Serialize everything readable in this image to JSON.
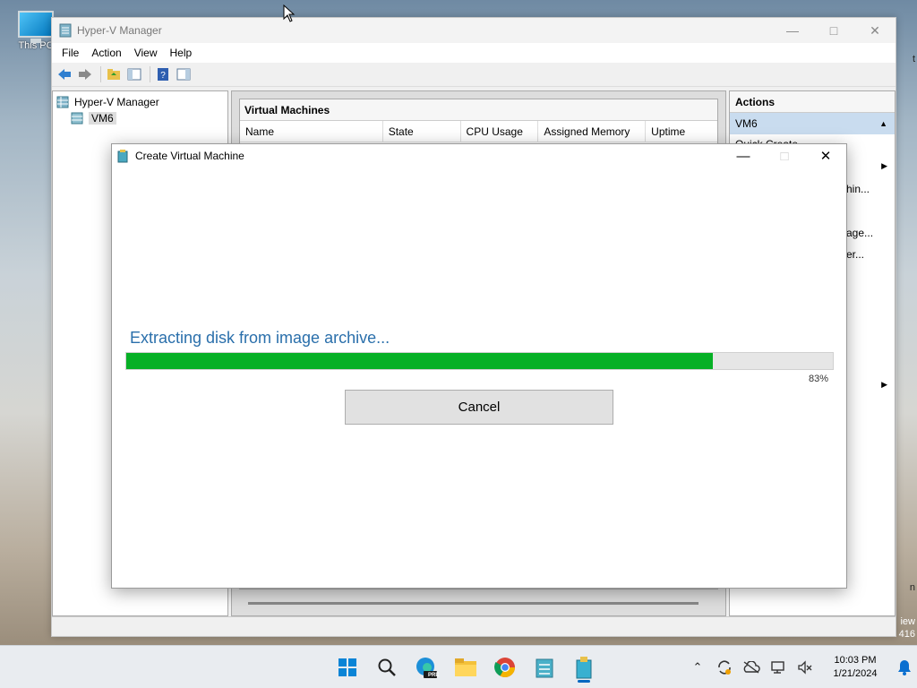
{
  "desktop": {
    "icon_label": "This PC",
    "right_fragment_1": "t",
    "right_fragment_2": "n",
    "right_fragment_3": "iew",
    "right_fragment_4": "416"
  },
  "mmc": {
    "title": "Hyper-V Manager",
    "menu": [
      "File",
      "Action",
      "View",
      "Help"
    ],
    "tree_root": "Hyper-V Manager",
    "tree_node": "VM6",
    "vm_section_title": "Virtual Machines",
    "columns": [
      "Name",
      "State",
      "CPU Usage",
      "Assigned Memory",
      "Uptime"
    ],
    "actions_title": "Actions",
    "actions_sub": "VM6",
    "action_fragments": [
      "Quick Create...",
      "hin...",
      "age...",
      "er..."
    ]
  },
  "dialog": {
    "title": "Create Virtual Machine",
    "status_text": "Extracting disk from image archive...",
    "progress": 83,
    "progress_label": "83%",
    "cancel_label": "Cancel"
  },
  "taskbar": {
    "time": "10:03 PM",
    "date": "1/21/2024",
    "edge_badge": "PRE"
  },
  "colors": {
    "progress_fill": "#06b025",
    "status_text": "#2a6fab",
    "accent": "#0067c0"
  }
}
